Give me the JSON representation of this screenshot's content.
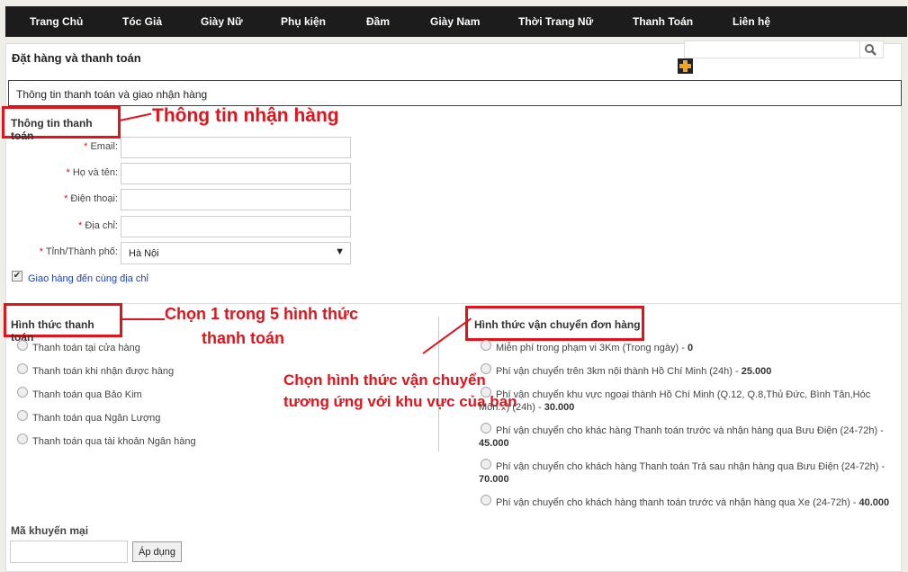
{
  "nav": [
    {
      "label": "Trang Chủ"
    },
    {
      "label": "Tóc Giả"
    },
    {
      "label": "Giày Nữ"
    },
    {
      "label": "Phụ kiện"
    },
    {
      "label": "Đầm"
    },
    {
      "label": "Giày Nam"
    },
    {
      "label": "Thời Trang Nữ"
    },
    {
      "label": "Thanh Toán"
    },
    {
      "label": "Liên hệ"
    }
  ],
  "page_title": "Đặt hàng và thanh toán",
  "section_title": "Thông tin thanh toán và giao nhận hàng",
  "billing": {
    "heading": "Thông tin thanh toán",
    "annotation": "Thông tin nhận hàng",
    "fields": [
      {
        "label": "Email:"
      },
      {
        "label": "Họ và tên:"
      },
      {
        "label": "Điện thoại:"
      },
      {
        "label": "Địa chỉ:"
      },
      {
        "label": "Tỉnh/Thành phố:"
      }
    ],
    "city_value": "Hà Nội",
    "same_address_label": "Giao hàng đến cùng địa chỉ"
  },
  "payment": {
    "heading": "Hình thức thanh toán",
    "annotation_line1": "Chọn 1 trong 5 hình thức",
    "annotation_line2": "thanh toán",
    "options": [
      "Thanh toán tại cửa hàng",
      "Thanh toán khi nhận được hàng",
      "Thanh toán qua Bảo Kim",
      "Thanh toán qua Ngân Lượng",
      "Thanh toán qua tài khoản Ngân hàng"
    ]
  },
  "shipping": {
    "heading": "Hình thức vận chuyển đơn hàng",
    "annotation_line1": "Chọn hình thức vận chuyển",
    "annotation_line2": "tương ứng với khu vực của bạn",
    "options": [
      {
        "text": "Miễn phí trong phạm vi 3Km (Trong ngày) - ",
        "price": "0"
      },
      {
        "text": "Phí vận chuyển trên 3km nội thành Hồ Chí Minh (24h) - ",
        "price": "25.000"
      },
      {
        "text": "Phí vận chuyển khu vực ngoại thành Hồ Chí Minh (Q.12, Q.8,Thủ Đức, Bình Tân,Hóc Môn...) (24h) - ",
        "price": "30.000"
      },
      {
        "text": "Phí vận chuyển cho khác hàng Thanh toán trước và nhận hàng qua Bưu Điện (24-72h) - ",
        "price": "45.000"
      },
      {
        "text": "Phí vận chuyển cho khách hàng Thanh toán Trả sau nhận hàng qua Bưu Điện (24-72h) - ",
        "price": "70.000"
      },
      {
        "text": "Phí vận chuyển cho khách hàng thanh toán trước và nhận hàng qua Xe (24-72h) - ",
        "price": "40.000"
      }
    ]
  },
  "promo": {
    "label": "Mã khuyến mại",
    "button": "Áp dụng"
  },
  "colors": {
    "nav_bg": "#1c1c1c",
    "annotation_red": "#e3131b",
    "link_blue": "#1a3fc6",
    "plus_orange": "#f7a21b"
  },
  "icons": {
    "search": "search-icon",
    "plus": "plus-icon",
    "dropdown": "chevron-down-icon"
  }
}
